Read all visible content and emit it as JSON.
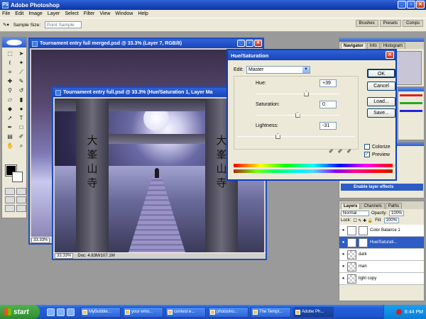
{
  "app": {
    "title": "Adobe Photoshop"
  },
  "menu": [
    "File",
    "Edit",
    "Image",
    "Layer",
    "Select",
    "Filter",
    "View",
    "Window",
    "Help"
  ],
  "options": {
    "label": "Sample Size:",
    "value": "Point Sample"
  },
  "palette_well": [
    "Brushes",
    "Presets",
    "Comps"
  ],
  "doc_back": {
    "title": "Tournament entry full merged.psd @ 33.3% (Layer 7, RGB/8)",
    "zoom": "33.33%"
  },
  "doc_front": {
    "title": "Tournament entry full.psd @ 33.3% (Hue/Saturation 1, Layer Ma",
    "zoom": "33.33%",
    "doc_size": "Doc: 4.83M/107.1M",
    "kanji_left": [
      "大",
      "峯",
      "山",
      "寺"
    ],
    "kanji_right": [
      "大",
      "峯",
      "山",
      "寺"
    ]
  },
  "dialog": {
    "title": "Hue/Saturation",
    "edit_label": "Edit:",
    "edit_value": "Master",
    "hue_label": "Hue:",
    "hue_value": "+39",
    "sat_label": "Saturation:",
    "sat_value": "0",
    "light_label": "Lightness:",
    "light_value": "-31",
    "ok": "OK",
    "cancel": "Cancel",
    "load": "Load...",
    "save": "Save...",
    "colorize": "Colorize",
    "preview": "Preview",
    "hue": 39,
    "saturation": 0,
    "lightness": -31,
    "colorize_checked": false,
    "preview_checked": true
  },
  "navigator_tabs": [
    "Navigator",
    "Info",
    "Histogram"
  ],
  "layer_effects_label": "Enable layer effects",
  "layers_panel": {
    "tabs": [
      "Layers",
      "Channels",
      "Paths"
    ],
    "blend_mode": "Normal",
    "opacity_label": "Opacity:",
    "opacity": "100%",
    "lock_label": "Lock:",
    "fill_label": "Fill:",
    "fill": "100%",
    "layers": [
      {
        "name": "Color Balance 1",
        "selected": false
      },
      {
        "name": "Hue/Saturati...",
        "selected": true
      },
      {
        "name": "dark",
        "selected": false
      },
      {
        "name": "man",
        "selected": false
      },
      {
        "name": "light copy",
        "selected": false
      }
    ]
  },
  "taskbar": {
    "start": "start",
    "tasks": [
      "MyBubble...",
      "your emo...",
      "contest e...",
      "photosho...",
      "The Templ...",
      "Adobe Ph..."
    ],
    "clock": "8:44 PM"
  }
}
